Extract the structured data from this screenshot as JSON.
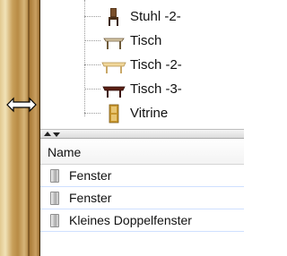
{
  "tree": {
    "items": [
      {
        "label": "Stuhl -2-",
        "icon": "chair-icon"
      },
      {
        "label": "Tisch",
        "icon": "table-icon"
      },
      {
        "label": "Tisch -2-",
        "icon": "table-light-icon"
      },
      {
        "label": "Tisch -3-",
        "icon": "table-dark-icon"
      },
      {
        "label": "Vitrine",
        "icon": "cabinet-icon"
      }
    ]
  },
  "list": {
    "column_name": "Name",
    "rows": [
      {
        "label": "Fenster",
        "icon": "window-icon"
      },
      {
        "label": "Fenster",
        "icon": "window-icon"
      },
      {
        "label": "Kleines Doppelfenster",
        "icon": "double-window-icon"
      }
    ]
  },
  "colors": {
    "wood": "#b88b45",
    "row_border": "#cfe0ff"
  }
}
